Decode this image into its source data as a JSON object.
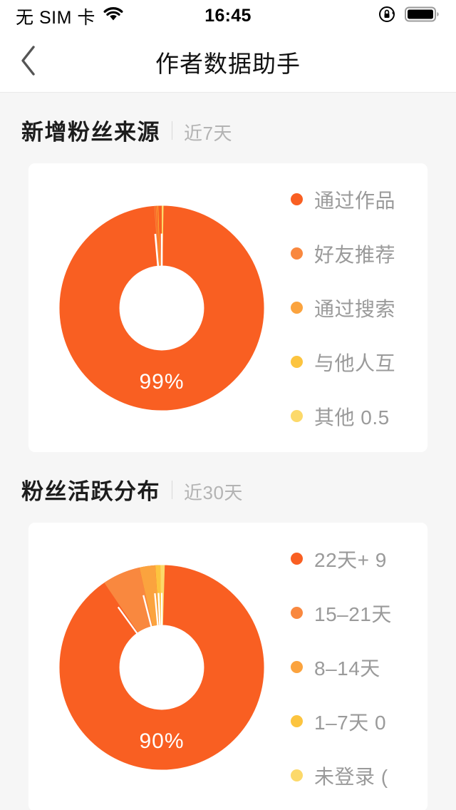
{
  "status_bar": {
    "carrier": "无 SIM 卡",
    "wifi_icon": "wifi-icon",
    "time": "16:45",
    "rotation_lock_icon": "rotation-lock-icon",
    "battery_icon": "battery-full-icon"
  },
  "nav": {
    "back_icon": "chevron-left-icon",
    "title": "作者数据助手"
  },
  "sections": [
    {
      "title": "新增粉丝来源",
      "subtitle": "近7天",
      "center_label": "99%",
      "legend": [
        {
          "label": "通过作品",
          "color": "#f95f22"
        },
        {
          "label": "好友推荐",
          "color": "#f9883f"
        },
        {
          "label": "通过搜索",
          "color": "#fba33e"
        },
        {
          "label": "与他人互",
          "color": "#fcc43f"
        },
        {
          "label": "其他 0.5",
          "color": "#fcd96a"
        }
      ]
    },
    {
      "title": "粉丝活跃分布",
      "subtitle": "近30天",
      "center_label": "90%",
      "legend": [
        {
          "label": "22天+ 9",
          "color": "#f95f22"
        },
        {
          "label": "15–21天",
          "color": "#f9883f"
        },
        {
          "label": "8–14天",
          "color": "#fba33e"
        },
        {
          "label": "1–7天 0",
          "color": "#fcc43f"
        },
        {
          "label": "未登录 (",
          "color": "#fcd96a"
        }
      ]
    }
  ],
  "chart_data": [
    {
      "type": "pie",
      "title": "新增粉丝来源",
      "subtitle": "近7天",
      "donut": true,
      "center_label": "99%",
      "categories": [
        "通过作品",
        "好友推荐",
        "通过搜索",
        "与他人互",
        "其他"
      ],
      "values": [
        99,
        0.2,
        0.2,
        0.1,
        0.5
      ],
      "colors": [
        "#f95f22",
        "#f9883f",
        "#fba33e",
        "#fcc43f",
        "#fcd96a"
      ],
      "legend_position": "right",
      "start_angle": -90
    },
    {
      "type": "pie",
      "title": "粉丝活跃分布",
      "subtitle": "近30天",
      "donut": true,
      "center_label": "90%",
      "categories": [
        "22天+",
        "15–21天",
        "8–14天",
        "1–7天",
        "未登录"
      ],
      "values": [
        90,
        6,
        2.5,
        0.8,
        0.7
      ],
      "colors": [
        "#f95f22",
        "#f9883f",
        "#fba33e",
        "#fcc43f",
        "#fcd96a"
      ],
      "legend_position": "right",
      "start_angle": -90
    }
  ]
}
